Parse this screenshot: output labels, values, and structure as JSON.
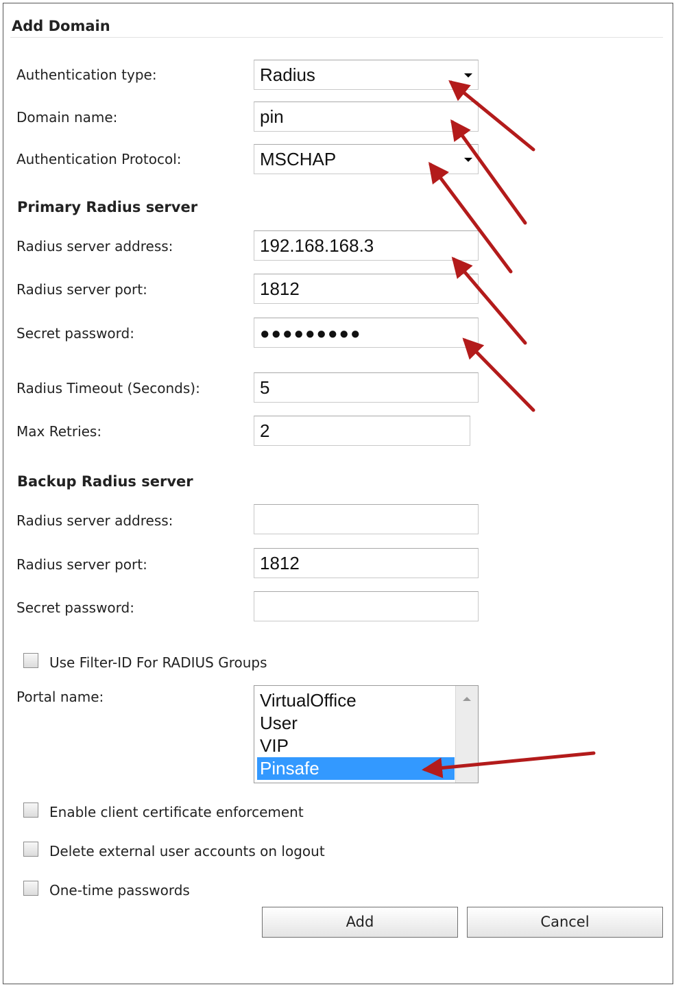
{
  "form": {
    "title": "Add Domain",
    "fields": {
      "auth_type": {
        "label": "Authentication type:",
        "value": "Radius"
      },
      "domain_name": {
        "label": "Domain name:",
        "value": "pin"
      },
      "auth_protocol": {
        "label": "Authentication Protocol:",
        "value": "MSCHAP"
      }
    },
    "primary": {
      "heading": "Primary Radius server",
      "address": {
        "label": "Radius server address:",
        "value": "192.168.168.3"
      },
      "port": {
        "label": "Radius server port:",
        "value": "1812"
      },
      "secret": {
        "label": "Secret password:",
        "value": "●●●●●●●●●"
      },
      "timeout": {
        "label": "Radius Timeout (Seconds):",
        "value": "5"
      },
      "retries": {
        "label": "Max Retries:",
        "value": "2"
      }
    },
    "backup": {
      "heading": "Backup Radius server",
      "address": {
        "label": "Radius server address:",
        "value": ""
      },
      "port": {
        "label": "Radius server port:",
        "value": "1812"
      },
      "secret": {
        "label": "Secret password:",
        "value": ""
      }
    },
    "filter_id": {
      "label": "Use Filter-ID For RADIUS Groups",
      "checked": false
    },
    "portal": {
      "label": "Portal name:",
      "options": [
        "VirtualOffice",
        "User",
        "VIP",
        "Pinsafe"
      ],
      "selected": "Pinsafe"
    },
    "options": {
      "client_cert": {
        "label": "Enable client certificate enforcement",
        "checked": false
      },
      "delete_accounts": {
        "label": "Delete external user accounts on logout",
        "checked": false
      },
      "otp": {
        "label": "One-time passwords",
        "checked": false
      }
    },
    "buttons": {
      "add": "Add",
      "cancel": "Cancel"
    }
  },
  "colors": {
    "arrow": "#b31b1b",
    "selection": "#3399ff"
  },
  "icons": {
    "dropdown": "chevron-down-icon",
    "scroll": "scroll-up-icon",
    "annotation": "red-arrow-icon"
  }
}
